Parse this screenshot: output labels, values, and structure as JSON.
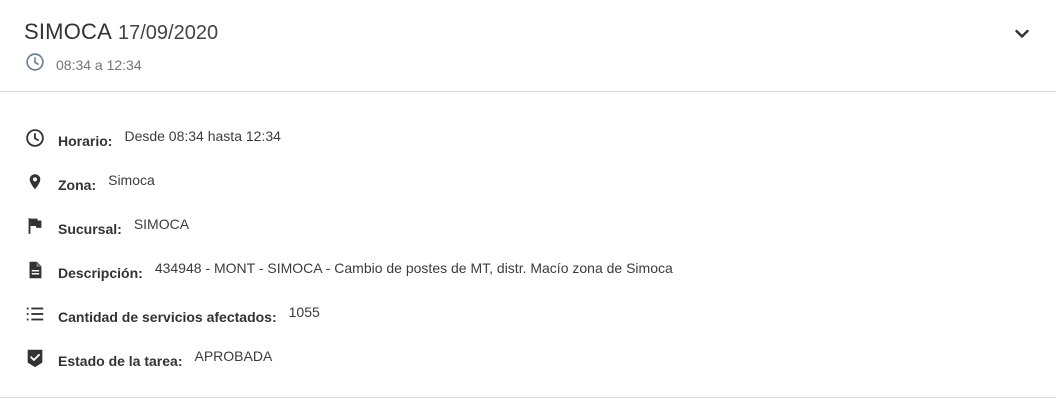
{
  "header": {
    "title": "SIMOCA",
    "date": "17/09/2020",
    "time_range": "08:34 a 12:34"
  },
  "details": [
    {
      "icon": "clock-icon",
      "label": "Horario:",
      "value": "Desde 08:34 hasta 12:34"
    },
    {
      "icon": "location-pin-icon",
      "label": "Zona:",
      "value": "Simoca"
    },
    {
      "icon": "flag-icon",
      "label": "Sucursal:",
      "value": "SIMOCA"
    },
    {
      "icon": "document-icon",
      "label": "Descripción:",
      "value": "434948 - MONT - SIMOCA - Cambio de postes de MT, distr. Macío zona de Simoca"
    },
    {
      "icon": "numbered-list-icon",
      "label": "Cantidad de servicios afectados:",
      "value": "1055"
    },
    {
      "icon": "check-shield-icon",
      "label": "Estado de la tarea:",
      "value": "APROBADA"
    }
  ],
  "colors": {
    "text": "#333333",
    "muted": "#757575",
    "divider": "#d9d9d9"
  }
}
